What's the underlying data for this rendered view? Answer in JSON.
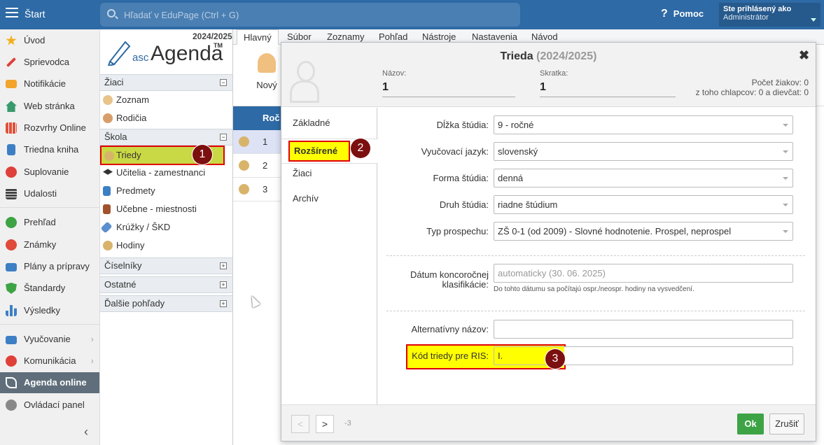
{
  "topbar": {
    "start_label": "Štart",
    "search_placeholder": "Hľadať v EduPage (Ctrl + G)",
    "help_label": "Pomoc",
    "user_line1": "Ste prihlásený ako",
    "user_line2": "Administrátor"
  },
  "left_nav": {
    "items": [
      {
        "label": "Úvod",
        "icon": "star-icon",
        "color": "#f2b01e"
      },
      {
        "label": "Sprievodca",
        "icon": "wand-icon",
        "color": "#e0403a"
      },
      {
        "label": "Notifikácie",
        "icon": "envelope-icon",
        "color": "#f2a52a"
      },
      {
        "label": "Web stránka",
        "icon": "home-icon",
        "color": "#3a9a6c"
      },
      {
        "label": "Rozvrhy Online",
        "icon": "timetable-icon",
        "color": "#e0503a"
      },
      {
        "label": "Triedna kniha",
        "icon": "book-icon",
        "color": "#3d7fc4"
      },
      {
        "label": "Suplovanie",
        "icon": "person-icon",
        "color": "#e0403a"
      },
      {
        "label": "Udalosti",
        "icon": "calendar-icon",
        "color": "#444"
      },
      {
        "label": "Prehľad",
        "icon": "check-icon",
        "color": "#3da345"
      },
      {
        "label": "Známky",
        "icon": "grade-icon",
        "color": "#e04a3a"
      },
      {
        "label": "Plány a prípravy",
        "icon": "briefcase-icon",
        "color": "#3d7fc4"
      },
      {
        "label": "Štandardy",
        "icon": "shield-icon",
        "color": "#3da345"
      },
      {
        "label": "Výsledky",
        "icon": "bar-chart-icon",
        "color": "#3d7fc4"
      },
      {
        "label": "Vyučovanie",
        "icon": "book-open-icon",
        "color": "#3d7fc4"
      },
      {
        "label": "Komunikácia",
        "icon": "chat-icon",
        "color": "#e0403a"
      },
      {
        "label": "Agenda online",
        "icon": "agenda-icon",
        "color": "#ffffff"
      },
      {
        "label": "Ovládací panel",
        "icon": "gear-icon",
        "color": "#888"
      }
    ]
  },
  "mid": {
    "year": "2024/2025",
    "logo_asc": "asc",
    "logo_agenda": "Agenda",
    "logo_tm": "TM",
    "sections": {
      "ziaci": "Žiaci",
      "skola": "Škola",
      "ciselniky": "Číselníky",
      "ostatne": "Ostatné",
      "dalsie": "Ďalšie pohľady"
    },
    "ziaci_items": [
      "Zoznam",
      "Rodičia"
    ],
    "skola_items": [
      "Triedy",
      "Učitelia - zamestnanci",
      "Predmety",
      "Učebne - miestnosti",
      "Krúžky / ŠKD",
      "Hodiny"
    ],
    "plus": "+",
    "minus": "−"
  },
  "menu_tabs": [
    "Hlavný",
    "Súbor",
    "Zoznamy",
    "Pohľad",
    "Nástroje",
    "Nastavenia",
    "Návod"
  ],
  "ribbon": {
    "new_label": "Nový"
  },
  "grid": {
    "header": "Roč",
    "rows": [
      "1",
      "2",
      "3"
    ]
  },
  "dialog": {
    "title": "Trieda",
    "title_year": "(2024/2025)",
    "close": "✖",
    "name_label": "Názov:",
    "name_value": "1",
    "short_label": "Skratka:",
    "short_value": "1",
    "count_line1": "Počet žiakov: 0",
    "count_line2": "z toho chlapcov: 0 a dievčat: 0",
    "tabs": [
      "Základné",
      "Rozšírené",
      "Žiaci",
      "Archív"
    ],
    "fields": {
      "dlzka_label": "Dĺžka štúdia:",
      "dlzka_value": "9 - ročné",
      "jazyk_label": "Vyučovací jazyk:",
      "jazyk_value": "slovenský",
      "forma_label": "Forma štúdia:",
      "forma_value": "denná",
      "druh_label": "Druh štúdia:",
      "druh_value": "riadne štúdium",
      "typ_label": "Typ prospechu:",
      "typ_value": "ZŠ 0-1 (od 2009) - Slovné hodnotenie. Prospel, neprospel",
      "datum_label1": "Dátum koncoročnej",
      "datum_label2": "klasifikácie:",
      "datum_placeholder": "automaticky (30. 06. 2025)",
      "datum_hint": "Do tohto dátumu sa počítajú ospr./neospr. hodiny na vysvedčení.",
      "alt_label": "Alternatívny názov:",
      "alt_value": "",
      "ris_label": "Kód triedy pre RIS:",
      "ris_value": "I."
    },
    "nav_prev": "<",
    "nav_next": ">",
    "page_indicator": "-3",
    "ok": "Ok",
    "cancel": "Zrušiť"
  },
  "annotations": {
    "b1": "1",
    "b2": "2",
    "b3": "3"
  },
  "colors": {
    "topbar": "#2e6aa5",
    "highlight_yellow": "#ffff00",
    "highlight_border": "#e00000",
    "selected_row": "#c9d845",
    "ok_green": "#3da345",
    "badge": "#7c0f0f"
  }
}
